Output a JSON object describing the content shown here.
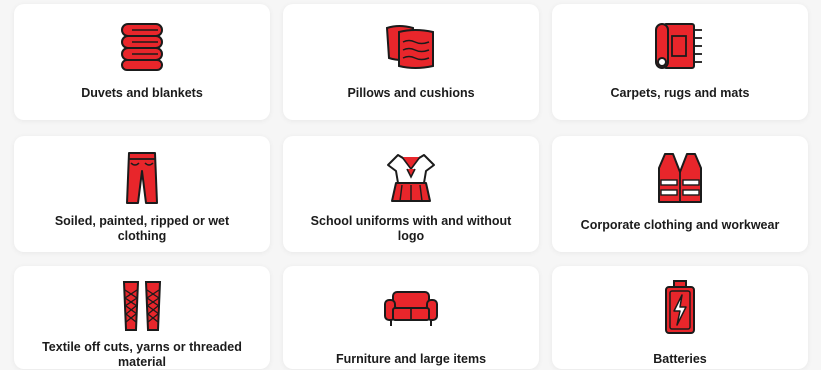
{
  "items": [
    {
      "label": "Duvets and blankets",
      "icon": "blanket-stack-icon"
    },
    {
      "label": "Pillows and cushions",
      "icon": "pillows-icon"
    },
    {
      "label": "Carpets, rugs and mats",
      "icon": "rolled-carpet-icon"
    },
    {
      "label": "Soiled, painted, ripped or wet clothing",
      "icon": "trousers-icon"
    },
    {
      "label": "School uniforms with and without logo",
      "icon": "school-uniform-icon"
    },
    {
      "label": "Corporate clothing and workwear",
      "icon": "hi-vis-vest-icon"
    },
    {
      "label": "Textile off cuts, yarns or threaded material",
      "icon": "yarn-spools-icon"
    },
    {
      "label": "Furniture and large items",
      "icon": "sofa-icon"
    },
    {
      "label": "Batteries",
      "icon": "battery-icon"
    }
  ],
  "colors": {
    "accent": "#e8262b",
    "outline": "#1b1b1b",
    "card": "#ffffff",
    "background": "#f6f6f6"
  }
}
